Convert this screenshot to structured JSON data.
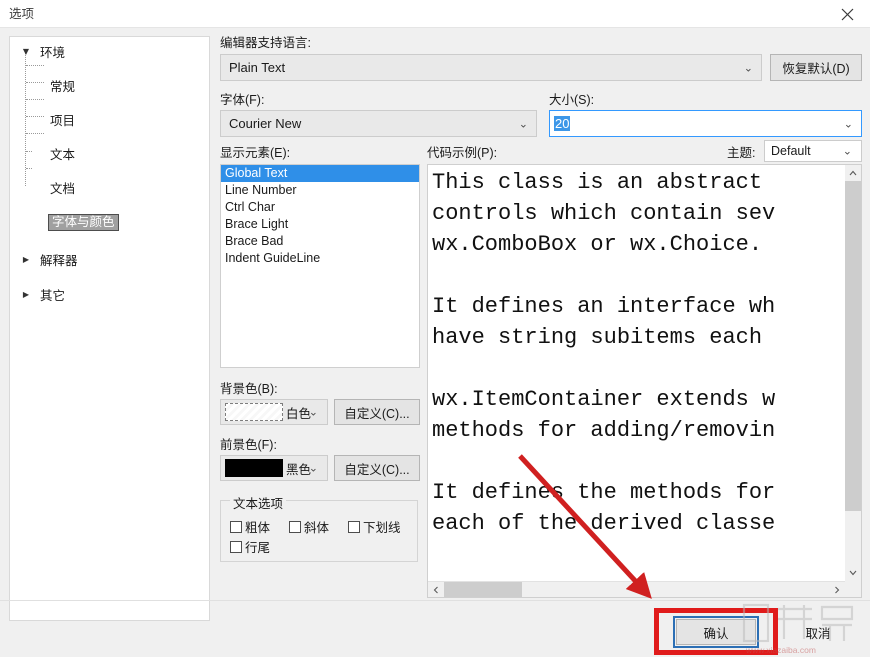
{
  "window": {
    "title": "选项",
    "close_icon": "close-x-icon"
  },
  "tree": {
    "items": [
      {
        "label": "环境",
        "level": 0,
        "expanded": true,
        "arrow": "▼",
        "selected": false
      },
      {
        "label": "常规",
        "level": 1,
        "expanded": null,
        "arrow": "",
        "selected": false
      },
      {
        "label": "项目",
        "level": 1,
        "expanded": null,
        "arrow": "",
        "selected": false
      },
      {
        "label": "文本",
        "level": 1,
        "expanded": null,
        "arrow": "",
        "selected": false
      },
      {
        "label": "文档",
        "level": 1,
        "expanded": null,
        "arrow": "",
        "selected": false
      },
      {
        "label": "字体与颜色",
        "level": 1,
        "expanded": null,
        "arrow": "",
        "selected": true
      },
      {
        "label": "解释器",
        "level": 0,
        "expanded": false,
        "arrow": "▶",
        "selected": false
      },
      {
        "label": "其它",
        "level": 0,
        "expanded": false,
        "arrow": "▶",
        "selected": false
      }
    ]
  },
  "language": {
    "label": "编辑器支持语言:",
    "value": "Plain Text",
    "chevron": "⌄",
    "restore_default_label": "恢复默认(D)"
  },
  "font": {
    "label": "字体(F):",
    "value": "Courier New",
    "chevron": "⌄"
  },
  "size": {
    "label": "大小(S):",
    "value": "20",
    "chevron": "⌄"
  },
  "display_elements": {
    "label": "显示元素(E):",
    "items": [
      "Global Text",
      "Line Number",
      "Ctrl Char",
      "Brace Light",
      "Brace Bad",
      "Indent GuideLine"
    ],
    "selected_index": 0
  },
  "background_color": {
    "label": "背景色(B):",
    "value": "白色",
    "swatch_hex": "#ffffff",
    "chevron": "⌄",
    "custom_label": "自定义(C)..."
  },
  "foreground_color": {
    "label": "前景色(F):",
    "value": "黑色",
    "swatch_hex": "#000000",
    "chevron": "⌄",
    "custom_label": "自定义(C)..."
  },
  "text_options": {
    "group_title": "文本选项",
    "checkboxes": [
      {
        "label": "粗体",
        "checked": false
      },
      {
        "label": "斜体",
        "checked": false
      },
      {
        "label": "下划线",
        "checked": false
      },
      {
        "label": "行尾",
        "checked": false
      }
    ]
  },
  "code_sample": {
    "label": "代码示例(P):",
    "theme_label": "主题:",
    "theme_value": "Default",
    "theme_chevron": "⌄",
    "text": "This class is an abstract\ncontrols which contain sev\nwx.ComboBox or wx.Choice.\n\nIt defines an interface wh\nhave string subitems each\n\nwx.ItemContainer extends w\nmethods for adding/removin\n\nIt defines the methods for\neach of the derived classe",
    "scroll_up_icon": "chevron-up-icon",
    "scroll_down_icon": "chevron-down-icon",
    "scroll_left_icon": "chevron-left-icon",
    "scroll_right_icon": "chevron-right-icon"
  },
  "footer": {
    "ok_label": "确认",
    "cancel_label": "取消"
  },
  "annotations": {
    "arrow_color": "#d02020",
    "highlight_color": "#e01b1b"
  },
  "watermark": {
    "text": "www.xiazaiba.com"
  }
}
